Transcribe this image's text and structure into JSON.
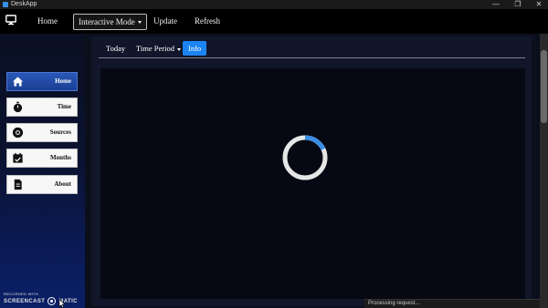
{
  "window": {
    "title": "DeskApp",
    "controls": {
      "minimize": "—",
      "maximize": "❐",
      "close": "✕"
    }
  },
  "nav": {
    "logo_icon": "monitor-icon",
    "items": [
      {
        "label": "Home"
      },
      {
        "label": "Interactive Mode",
        "dropdown": true
      },
      {
        "label": "Update"
      },
      {
        "label": "Refresh"
      }
    ]
  },
  "sidebar": {
    "items": [
      {
        "label": "Home",
        "icon": "home-icon",
        "active": true
      },
      {
        "label": "Time",
        "icon": "stopwatch-icon",
        "active": false
      },
      {
        "label": "Sources",
        "icon": "chrome-icon",
        "active": false
      },
      {
        "label": "Months",
        "icon": "calendar-check-icon",
        "active": false
      },
      {
        "label": "About",
        "icon": "document-icon",
        "active": false
      }
    ]
  },
  "tabs": [
    {
      "label": "Today",
      "active": false
    },
    {
      "label": "Time Period",
      "dropdown": true,
      "active": false
    },
    {
      "label": "Info",
      "active": true
    }
  ],
  "loading": {
    "progress": 0.18,
    "accent": "#3a8ee6",
    "track": "#e6e6e6"
  },
  "watermark": {
    "line1": "RECORDED WITH",
    "brand_left": "SCREENCAST",
    "brand_right": "MATIC"
  },
  "status": {
    "text": "Processing request..."
  },
  "colors": {
    "accent": "#1c84f2",
    "sidebar_active": "#2a58b8",
    "background": "#000000"
  }
}
